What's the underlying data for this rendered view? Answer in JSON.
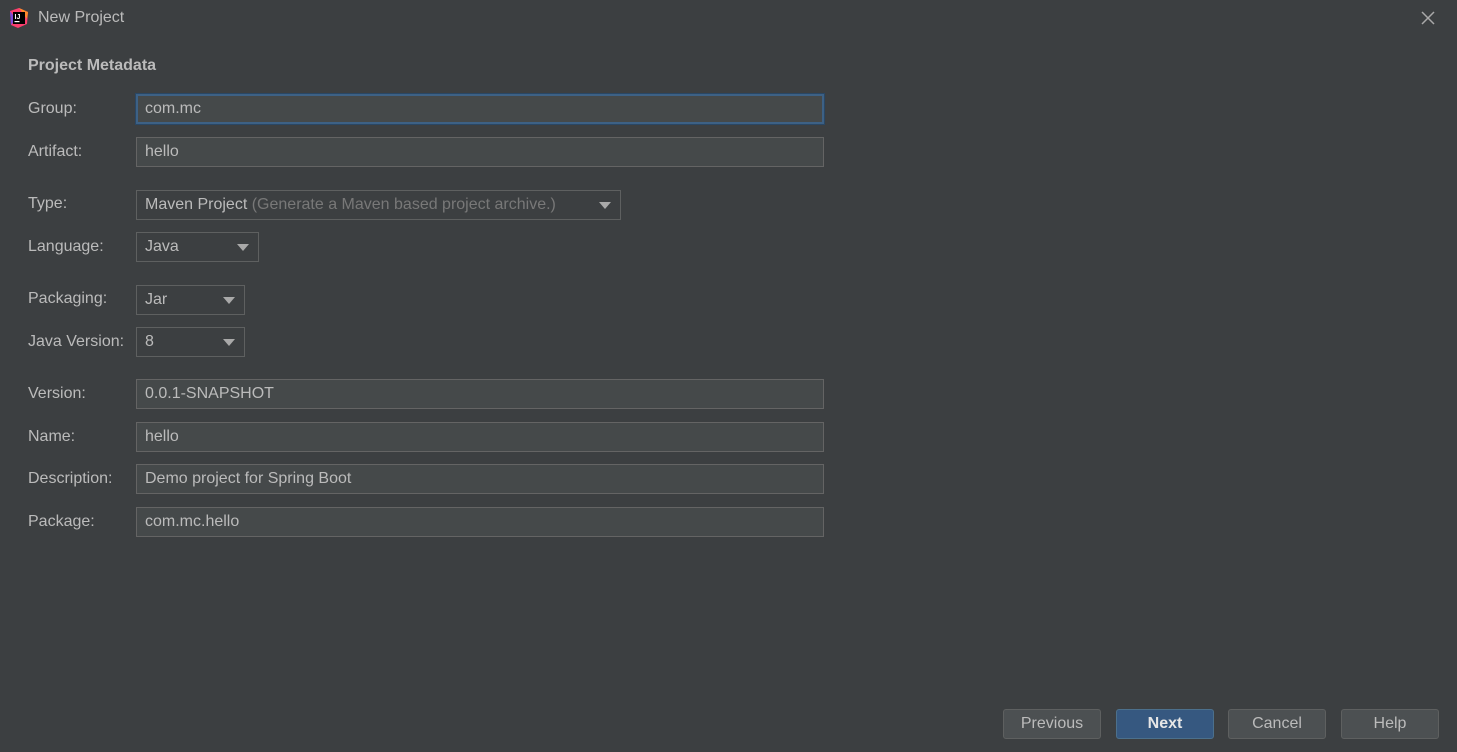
{
  "window": {
    "title": "New Project"
  },
  "icons": {
    "app": "intellij-idea-icon",
    "close": "close-icon",
    "dropdown": "chevron-down-icon"
  },
  "form": {
    "section_title": "Project Metadata",
    "group": {
      "label": "Group:",
      "value": "com.mc"
    },
    "artifact": {
      "label": "Artifact:",
      "value": "hello"
    },
    "type": {
      "label": "Type:",
      "value": "Maven Project",
      "hint": "(Generate a Maven based project archive.)"
    },
    "language": {
      "label": "Language:",
      "value": "Java"
    },
    "packaging": {
      "label": "Packaging:",
      "value": "Jar"
    },
    "java_version": {
      "label": "Java Version:",
      "value": "8"
    },
    "version": {
      "label": "Version:",
      "value": "0.0.1-SNAPSHOT"
    },
    "name": {
      "label": "Name:",
      "value": "hello"
    },
    "description": {
      "label": "Description:",
      "value": "Demo project for Spring Boot"
    },
    "package": {
      "label": "Package:",
      "value": "com.mc.hello"
    }
  },
  "buttons": {
    "previous": "Previous",
    "next": "Next",
    "cancel": "Cancel",
    "help": "Help"
  },
  "colors": {
    "background": "#3c3f41",
    "text": "#bbbbbb",
    "focus_border": "#3d6185",
    "primary_button": "#365880"
  }
}
